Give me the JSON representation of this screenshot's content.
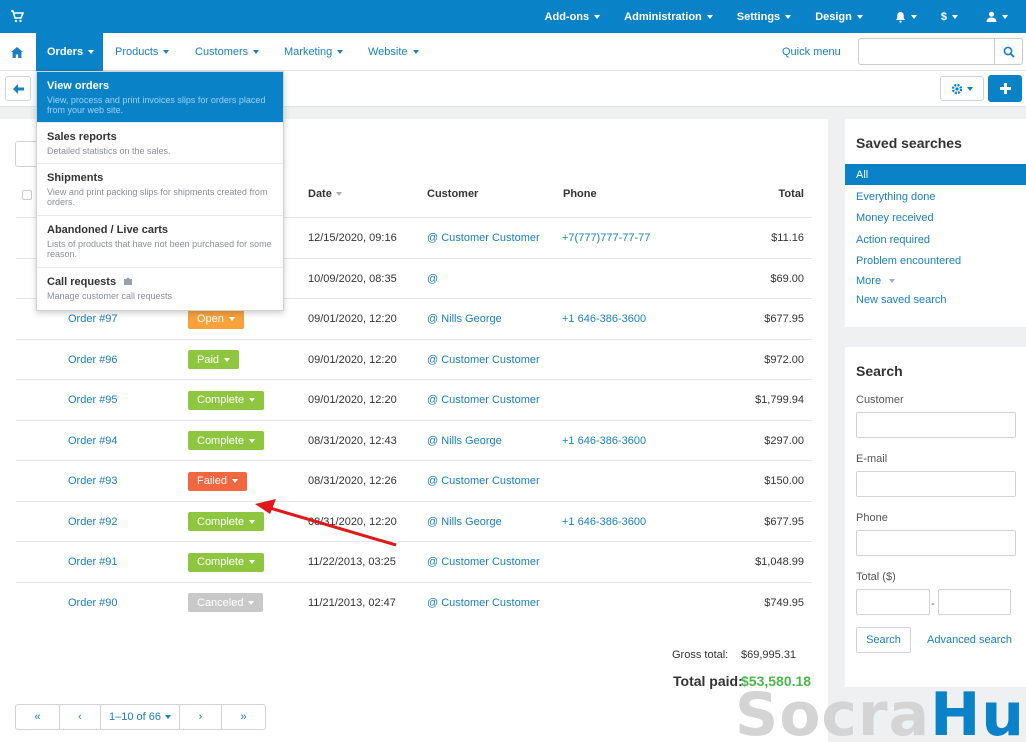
{
  "topbar": {
    "items": [
      "Add-ons",
      "Administration",
      "Settings",
      "Design"
    ],
    "currency": "$"
  },
  "mainnav": {
    "items": [
      "Orders",
      "Products",
      "Customers",
      "Marketing",
      "Website"
    ],
    "quick_menu": "Quick menu"
  },
  "orders_menu": [
    {
      "title": "View orders",
      "desc": "View, process and print invoices slips for orders placed from your web site."
    },
    {
      "title": "Sales reports",
      "desc": "Detailed statistics on the sales."
    },
    {
      "title": "Shipments",
      "desc": "View and print packing slips for shipments created from orders."
    },
    {
      "title": "Abandoned / Live carts",
      "desc": "Lists of products that have not been purchased for some reason."
    },
    {
      "title": "Call requests",
      "desc": "Manage customer call requests"
    }
  ],
  "table": {
    "headers": {
      "date": "Date",
      "customer": "Customer",
      "phone": "Phone",
      "total": "Total"
    },
    "rows": [
      {
        "order": "",
        "status": "",
        "date": "12/15/2020, 09:16",
        "customer": "@ Customer Customer",
        "phone": "+7(777)777-77-77",
        "total": "$11.16"
      },
      {
        "order": "",
        "status": "",
        "date": "10/09/2020, 08:35",
        "customer": "@",
        "phone": "",
        "total": "$69.00"
      },
      {
        "order": "Order #97",
        "status": "Open",
        "date": "09/01/2020, 12:20",
        "customer": "@ Nills George",
        "phone": "+1 646-386-3600",
        "total": "$677.95"
      },
      {
        "order": "Order #96",
        "status": "Paid",
        "date": "09/01/2020, 12:20",
        "customer": "@ Customer Customer",
        "phone": "",
        "total": "$972.00"
      },
      {
        "order": "Order #95",
        "status": "Complete",
        "date": "09/01/2020, 12:20",
        "customer": "@ Customer Customer",
        "phone": "",
        "total": "$1,799.94"
      },
      {
        "order": "Order #94",
        "status": "Complete",
        "date": "08/31/2020, 12:43",
        "customer": "@ Nills George",
        "phone": "+1 646-386-3600",
        "total": "$297.00"
      },
      {
        "order": "Order #93",
        "status": "Failed",
        "date": "08/31/2020, 12:26",
        "customer": "@ Customer Customer",
        "phone": "",
        "total": "$150.00"
      },
      {
        "order": "Order #92",
        "status": "Complete",
        "date": "08/31/2020, 12:20",
        "customer": "@ Nills George",
        "phone": "+1 646-386-3600",
        "total": "$677.95"
      },
      {
        "order": "Order #91",
        "status": "Complete",
        "date": "11/22/2013, 03:25",
        "customer": "@ Customer Customer",
        "phone": "",
        "total": "$1,048.99"
      },
      {
        "order": "Order #90",
        "status": "Canceled",
        "date": "11/21/2013, 02:47",
        "customer": "@ Customer Customer",
        "phone": "",
        "total": "$749.95"
      }
    ]
  },
  "status_colors": {
    "Open": "#f7a23b",
    "Paid": "#8ec63f",
    "Complete": "#8ec63f",
    "Failed": "#f26640",
    "Canceled": "#c8c8c8"
  },
  "totals": {
    "gross_label": "Gross total:",
    "gross_value": "$69,995.31",
    "paid_label": "Total paid:",
    "paid_value": "$53,580.18"
  },
  "pagination": {
    "first": "«",
    "prev": "‹",
    "range": "1–10 of 66",
    "next": "›",
    "last": "»"
  },
  "saved_searches": {
    "title": "Saved searches",
    "items": [
      "All",
      "Everything done",
      "Money received",
      "Action required",
      "Problem encountered",
      "More",
      "New saved search"
    ]
  },
  "search_panel": {
    "title": "Search",
    "customer_label": "Customer",
    "email_label": "E-mail",
    "phone_label": "Phone",
    "total_label": "Total ($)",
    "range_sep": "-",
    "search_button": "Search",
    "advanced_link": "Advanced search"
  },
  "watermark": {
    "part1": "Socra",
    "part2": "Hub"
  }
}
